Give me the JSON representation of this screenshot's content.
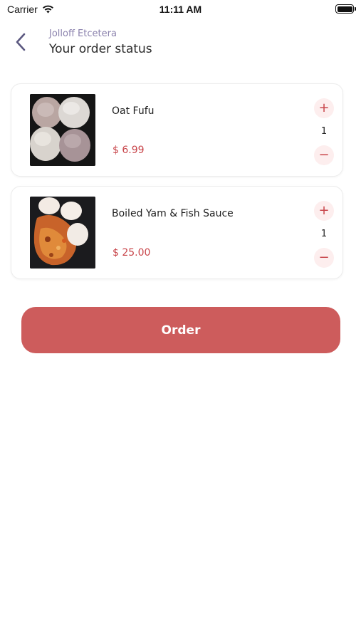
{
  "status_bar": {
    "carrier": "Carrier",
    "time": "11:11 AM",
    "icons": [
      "wifi-icon",
      "battery-icon"
    ]
  },
  "header": {
    "back_icon": "chevron-left-icon",
    "restaurant": "Jolloff Etcetera",
    "title": "Your order status"
  },
  "items": [
    {
      "name": "Oat Fufu",
      "price": "$ 6.99",
      "quantity": "1",
      "plus_label": "+",
      "minus_label": "−"
    },
    {
      "name": "Boiled Yam & Fish Sauce",
      "price": "$ 25.00",
      "quantity": "1",
      "plus_label": "+",
      "minus_label": "−"
    }
  ],
  "order_button": {
    "label": "Order"
  },
  "colors": {
    "accent": "#cd5c5c",
    "price": "#c8454a",
    "subtitle": "#8b82ad",
    "qty_bg": "#fdeeee"
  }
}
